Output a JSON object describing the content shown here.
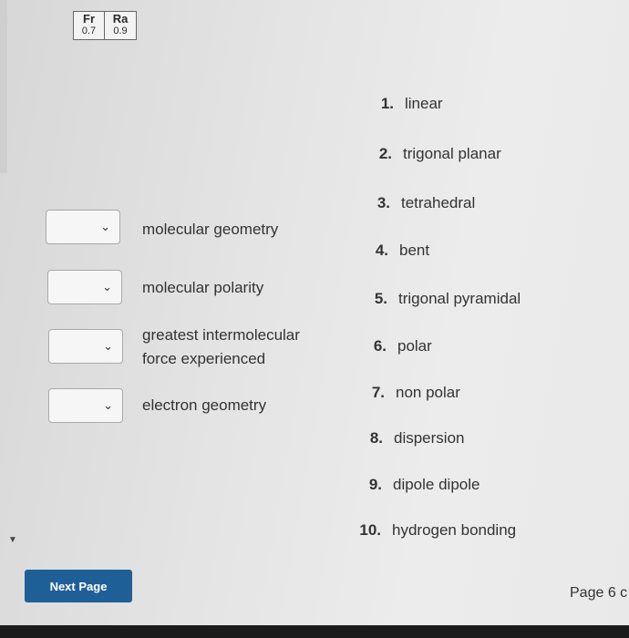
{
  "periodic_table": [
    {
      "symbol": "Fr",
      "value": "0.7"
    },
    {
      "symbol": "Ra",
      "value": "0.9"
    }
  ],
  "questions": [
    {
      "prompt": "molecular geometry",
      "selected": ""
    },
    {
      "prompt": "molecular polarity",
      "selected": ""
    },
    {
      "prompt": "greatest intermolecular force experienced",
      "selected": ""
    },
    {
      "prompt": "electron geometry",
      "selected": ""
    }
  ],
  "choices": [
    {
      "num": "1.",
      "label": "linear"
    },
    {
      "num": "2.",
      "label": "trigonal planar"
    },
    {
      "num": "3.",
      "label": "tetrahedral"
    },
    {
      "num": "4.",
      "label": "bent"
    },
    {
      "num": "5.",
      "label": "trigonal pyramidal"
    },
    {
      "num": "6.",
      "label": "polar"
    },
    {
      "num": "7.",
      "label": "non polar"
    },
    {
      "num": "8.",
      "label": "dispersion"
    },
    {
      "num": "9.",
      "label": "dipole dipole"
    },
    {
      "num": "10.",
      "label": "hydrogen bonding"
    }
  ],
  "footer": {
    "next_label": "Next Page",
    "page_indicator": "Page 6 c"
  },
  "colors": {
    "next_button": "#1f5f98",
    "background": "#e6e6e6"
  }
}
